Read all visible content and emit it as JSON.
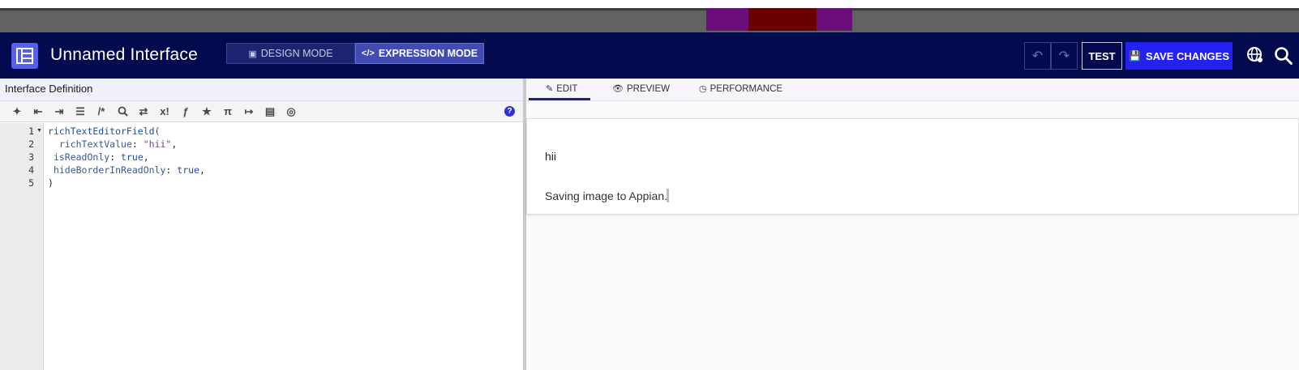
{
  "header": {
    "title": "Unnamed Interface",
    "design_mode_label": "DESIGN MODE",
    "expression_mode_label": "EXPRESSION MODE",
    "test_label": "TEST",
    "save_label": "SAVE CHANGES",
    "icons": [
      "interface-icon",
      "undo-icon",
      "redo-icon",
      "save-icon",
      "globe-icon",
      "search-icon"
    ]
  },
  "left_pane": {
    "title": "Interface Definition",
    "toolbar_icons": [
      "wand-icon",
      "outdent-icon",
      "indent-icon",
      "format-list-icon",
      "comment-icon",
      "search-icon",
      "shuffle-icon",
      "x1-icon",
      "function-icon",
      "star-icon",
      "pi-icon",
      "export-icon",
      "query-icon",
      "globe-icon",
      "help-icon"
    ],
    "toolbar_labels": {
      "comment": "/*",
      "x1": "x!",
      "fx": "ƒ",
      "pi": "π",
      "help": "?"
    },
    "line_numbers": [
      "1",
      "2",
      "3",
      "4",
      "5"
    ],
    "code": {
      "l1_fn": "richTextEditorField(",
      "l2_key": "richTextValue",
      "l2_val": "\"hii\"",
      "l3_key": "isReadOnly",
      "l3_val": "true",
      "l4_key": "hideBorderInReadOnly",
      "l4_val": "true",
      "l5": ")"
    }
  },
  "right_pane": {
    "tabs": [
      {
        "label": "EDIT",
        "icon": "edit-icon",
        "active": true
      },
      {
        "label": "PREVIEW",
        "icon": "eye-icon",
        "active": false
      },
      {
        "label": "PERFORMANCE",
        "icon": "clock-icon",
        "active": false
      }
    ],
    "rich_text_value": "hii",
    "status_text": "Saving image to Appian."
  },
  "colors": {
    "header_bg": "#030a4e",
    "save_button": "#2322f0",
    "expression_mode_active": "#414bb2"
  }
}
